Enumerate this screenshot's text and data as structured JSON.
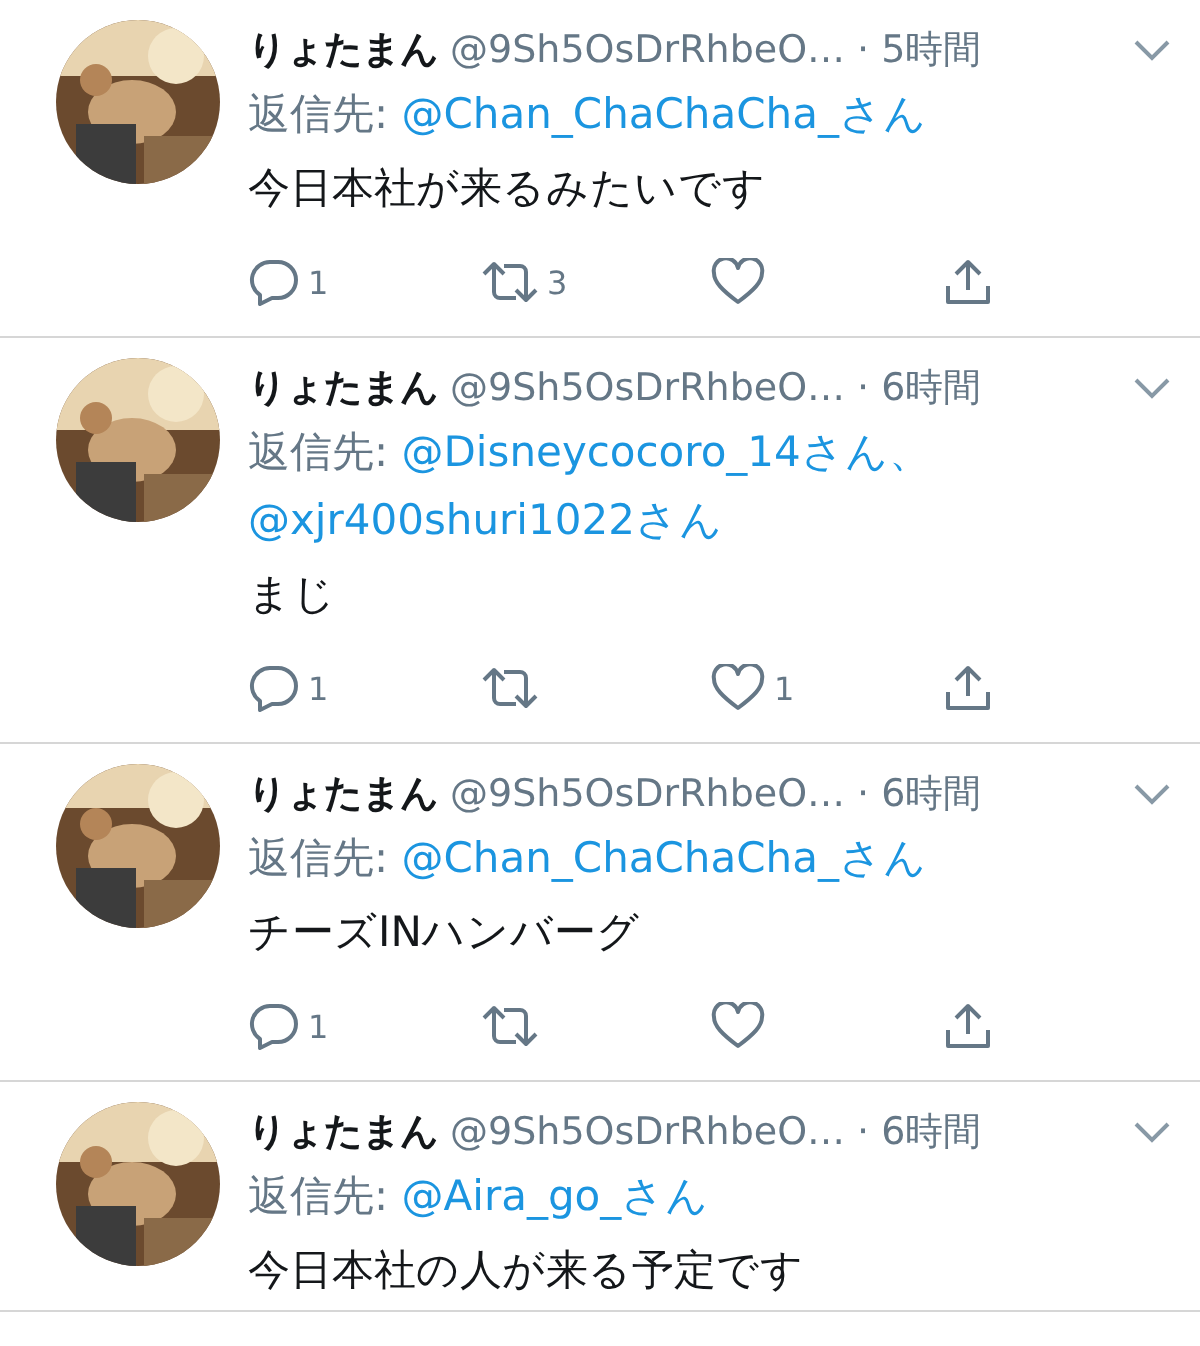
{
  "tweets": [
    {
      "name": "りょたまん",
      "handle": "@9Sh5OsDrRhbeO…",
      "time": "· 5時間",
      "reply_label": "返信先:",
      "mentions": [
        "@Chan_ChaChaCha_さん"
      ],
      "text": "今日本社が来るみたいです",
      "actions": [
        {
          "kind": "reply",
          "count": "1"
        },
        {
          "kind": "retweet",
          "count": "3"
        },
        {
          "kind": "like"
        },
        {
          "kind": "share"
        }
      ]
    },
    {
      "name": "りょたまん",
      "handle": "@9Sh5OsDrRhbeO…",
      "time": "· 6時間",
      "reply_label": "返信先:",
      "mentions": [
        "@Disneycocoro_14さん、",
        "@xjr400shuri1022さん"
      ],
      "text": "まじ",
      "actions": [
        {
          "kind": "reply",
          "count": "1"
        },
        {
          "kind": "retweet"
        },
        {
          "kind": "like",
          "count": "1"
        },
        {
          "kind": "share"
        }
      ]
    },
    {
      "name": "りょたまん",
      "handle": "@9Sh5OsDrRhbeO…",
      "time": "· 6時間",
      "reply_label": "返信先:",
      "mentions": [
        "@Chan_ChaChaCha_さん"
      ],
      "text": "チーズINハンバーグ",
      "actions": [
        {
          "kind": "reply",
          "count": "1"
        },
        {
          "kind": "retweet"
        },
        {
          "kind": "like"
        },
        {
          "kind": "share"
        }
      ]
    },
    {
      "name": "りょたまん",
      "handle": "@9Sh5OsDrRhbeO…",
      "time": "· 6時間",
      "reply_label": "返信先:",
      "mentions": [
        "@Aira_go_さん"
      ],
      "text": "今日本社の人が来る予定です"
    }
  ]
}
